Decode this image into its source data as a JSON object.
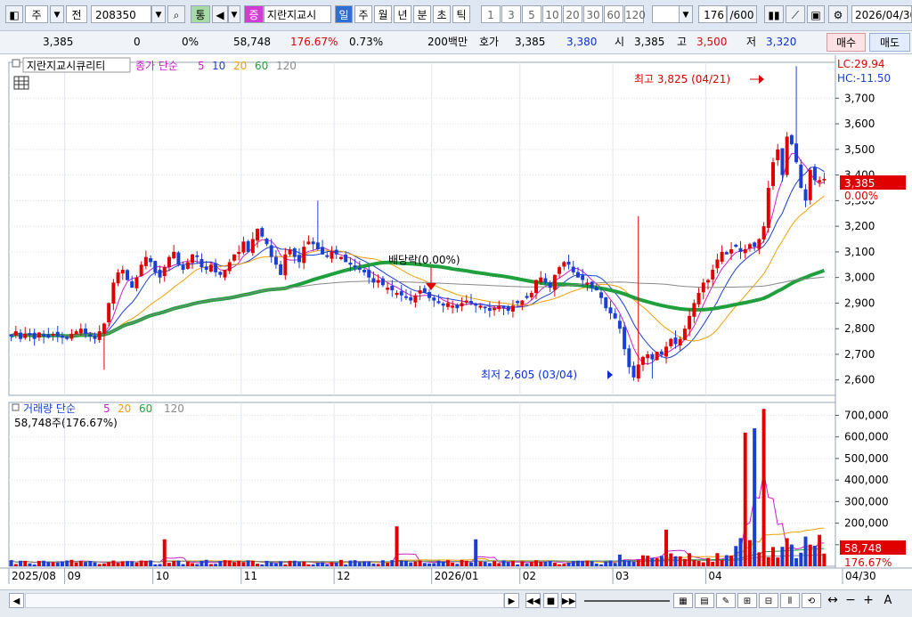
{
  "toolbar": {
    "market_label": "주",
    "prev_label": "전",
    "code": "208350",
    "tong_label": "통",
    "jeung_label": "증",
    "name": "지란지교시",
    "periods": [
      "일",
      "주",
      "월",
      "년",
      "분",
      "초",
      "틱"
    ],
    "intervals": [
      "1",
      "3",
      "5",
      "10",
      "20",
      "30",
      "60",
      "120"
    ],
    "count": "176",
    "count_total": "/600",
    "date": "2026/04/30"
  },
  "quote": {
    "price": "3,385",
    "change": "0",
    "change_pct": "0%",
    "volume": "58,748",
    "volume_ratio": "176.67%",
    "turnover": "0.73%",
    "amount": "200백만",
    "hoga_label": "호가",
    "ask": "3,385",
    "bid": "3,380",
    "open_label": "시",
    "open": "3,385",
    "high_label": "고",
    "high": "3,500",
    "low_label": "저",
    "low": "3,320",
    "buy_label": "매수",
    "sell_label": "매도"
  },
  "price_panel": {
    "title": "지란지교시큐리티",
    "ma_label": "종가 단순",
    "ma_periods": [
      "5",
      "10",
      "20",
      "60",
      "120"
    ],
    "lc_label": "LC:29.94",
    "hc_label": "HC:-11.50",
    "current_price": "3,385",
    "current_pct": "0.00%",
    "high_annotation": "최고 3,825 (04/21)",
    "low_annotation": "최저 2,605 (03/04)",
    "dividend_annotation": "배당락(0.00%)"
  },
  "volume_panel": {
    "title": "거래량 단순",
    "ma_periods": [
      "5",
      "20",
      "60",
      "120"
    ],
    "current_text": "58,748주(176.67%)",
    "current_volume": "58,748",
    "current_pct": "176.67%"
  },
  "x_axis": {
    "labels": [
      "2025/08",
      "09",
      "10",
      "11",
      "12",
      "2026/01",
      "02",
      "03",
      "04",
      "04/30"
    ]
  },
  "colors": {
    "up": "#e00000",
    "down": "#1a3fd6",
    "ma5": "#c81fc8",
    "ma10": "#1a3fd6",
    "ma20": "#f0a000",
    "ma60": "#1fa03c",
    "ma120": "#888888",
    "annotation_red": "#e00000",
    "annotation_blue": "#0b2fd6"
  },
  "chart_data": [
    {
      "type": "candlestick",
      "title": "지란지교시큐리티",
      "x_start": "2025/08",
      "x_end": "04/30",
      "ylim": [
        2540,
        3840
      ],
      "y_ticks": [
        2600,
        2700,
        2800,
        2900,
        3000,
        3100,
        3200,
        3300,
        3400,
        3500,
        3600,
        3700
      ],
      "grid": true,
      "close_series": [
        2770,
        2790,
        2760,
        2780,
        2775,
        2760,
        2785,
        2770,
        2765,
        2780,
        2770,
        2765,
        2760,
        2780,
        2790,
        2800,
        2780,
        2770,
        2760,
        2790,
        2820,
        2900,
        2980,
        3020,
        3030,
        2990,
        2960,
        3000,
        3050,
        3080,
        3060,
        3020,
        3000,
        3040,
        3080,
        3100,
        3050,
        3030,
        3060,
        3090,
        3080,
        3040,
        3030,
        3050,
        3020,
        3010,
        3030,
        3060,
        3090,
        3100,
        3140,
        3100,
        3150,
        3190,
        3160,
        3130,
        3080,
        3050,
        3010,
        3090,
        3110,
        3080,
        3060,
        3120,
        3140,
        3130,
        3110,
        3090,
        3080,
        3100,
        3090,
        3080,
        3060,
        3050,
        3040,
        3030,
        3020,
        3000,
        2980,
        2990,
        2970,
        2960,
        2950,
        2940,
        2930,
        2920,
        2910,
        2930,
        2950,
        2940,
        2920,
        2910,
        2900,
        2890,
        2900,
        2890,
        2880,
        2900,
        2910,
        2900,
        2890,
        2890,
        2880,
        2870,
        2880,
        2890,
        2880,
        2870,
        2890,
        2900,
        2910,
        2920,
        2940,
        2990,
        3000,
        2980,
        2960,
        3010,
        3040,
        3060,
        3050,
        3020,
        3000,
        2990,
        2980,
        2960,
        2950,
        2920,
        2880,
        2860,
        2840,
        2800,
        2720,
        2650,
        2610,
        2660,
        2690,
        2700,
        2680,
        2710,
        2700,
        2730,
        2760,
        2740,
        2760,
        2800,
        2850,
        2900,
        2940,
        2980,
        2990,
        3030,
        3070,
        3100,
        3090,
        3110,
        3120,
        3100,
        3110,
        3130,
        3120,
        3150,
        3200,
        3350,
        3450,
        3500,
        3400,
        3550,
        3520,
        3450,
        3350,
        3300,
        3420,
        3380,
        3380,
        3385
      ],
      "ma_periods": [
        5,
        10,
        20,
        60,
        120
      ],
      "max_point": {
        "date": "04/21",
        "value": 3825
      },
      "min_point": {
        "date": "03/04",
        "value": 2605
      },
      "last": {
        "value": 3385,
        "pct": "0.00%"
      },
      "events": [
        {
          "label": "배당락(0.00%)"
        }
      ]
    },
    {
      "type": "bar",
      "title": "거래량",
      "ylim": [
        0,
        760000
      ],
      "y_ticks": [
        100000,
        200000,
        300000,
        400000,
        500000,
        600000,
        700000
      ],
      "ma_periods": [
        5,
        20,
        60,
        120
      ],
      "last": {
        "value": 58748,
        "pct": "176.67%"
      },
      "spikes": [
        {
          "index": 33,
          "value": 125000
        },
        {
          "index": 83,
          "value": 185000
        },
        {
          "index": 100,
          "value": 125000
        },
        {
          "index": 141,
          "value": 170000
        },
        {
          "index": 158,
          "value": 620000
        },
        {
          "index": 160,
          "value": 640000
        },
        {
          "index": 162,
          "value": 730000
        }
      ]
    }
  ]
}
